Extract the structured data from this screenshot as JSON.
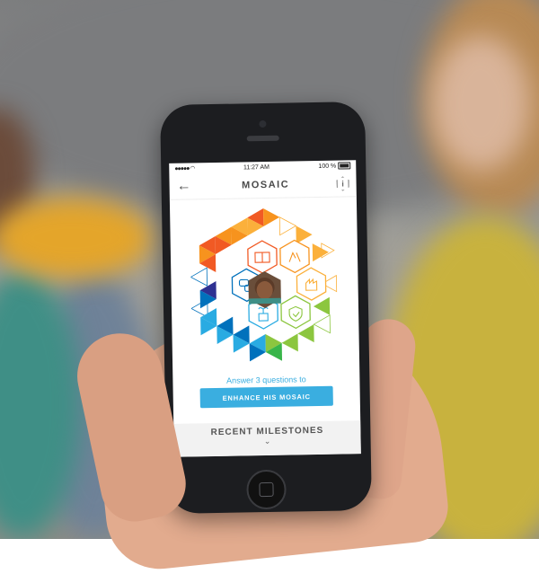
{
  "status_bar": {
    "time": "11:27 AM",
    "battery": "100 %"
  },
  "nav": {
    "title": "MOSAIC",
    "back_icon": "arrow-left-icon",
    "info_icon": "info-hexagon-icon"
  },
  "mosaic": {
    "center_icon": "child-photo",
    "icons": [
      "book-icon",
      "hands-icon",
      "hand-icon",
      "chat-icon",
      "sprout-icon",
      "shield-icon"
    ],
    "colors": [
      "#f15a24",
      "#f7931e",
      "#fbb03b",
      "#8cc63f",
      "#39b54a",
      "#29abe2",
      "#0071bc",
      "#2e3192",
      "#662d91"
    ]
  },
  "prompt_text": "Answer 3 questions to",
  "cta_label": "ENHANCE HIS MOSAIC",
  "milestones": {
    "title": "RECENT MILESTONES",
    "chevron": "⌄"
  }
}
